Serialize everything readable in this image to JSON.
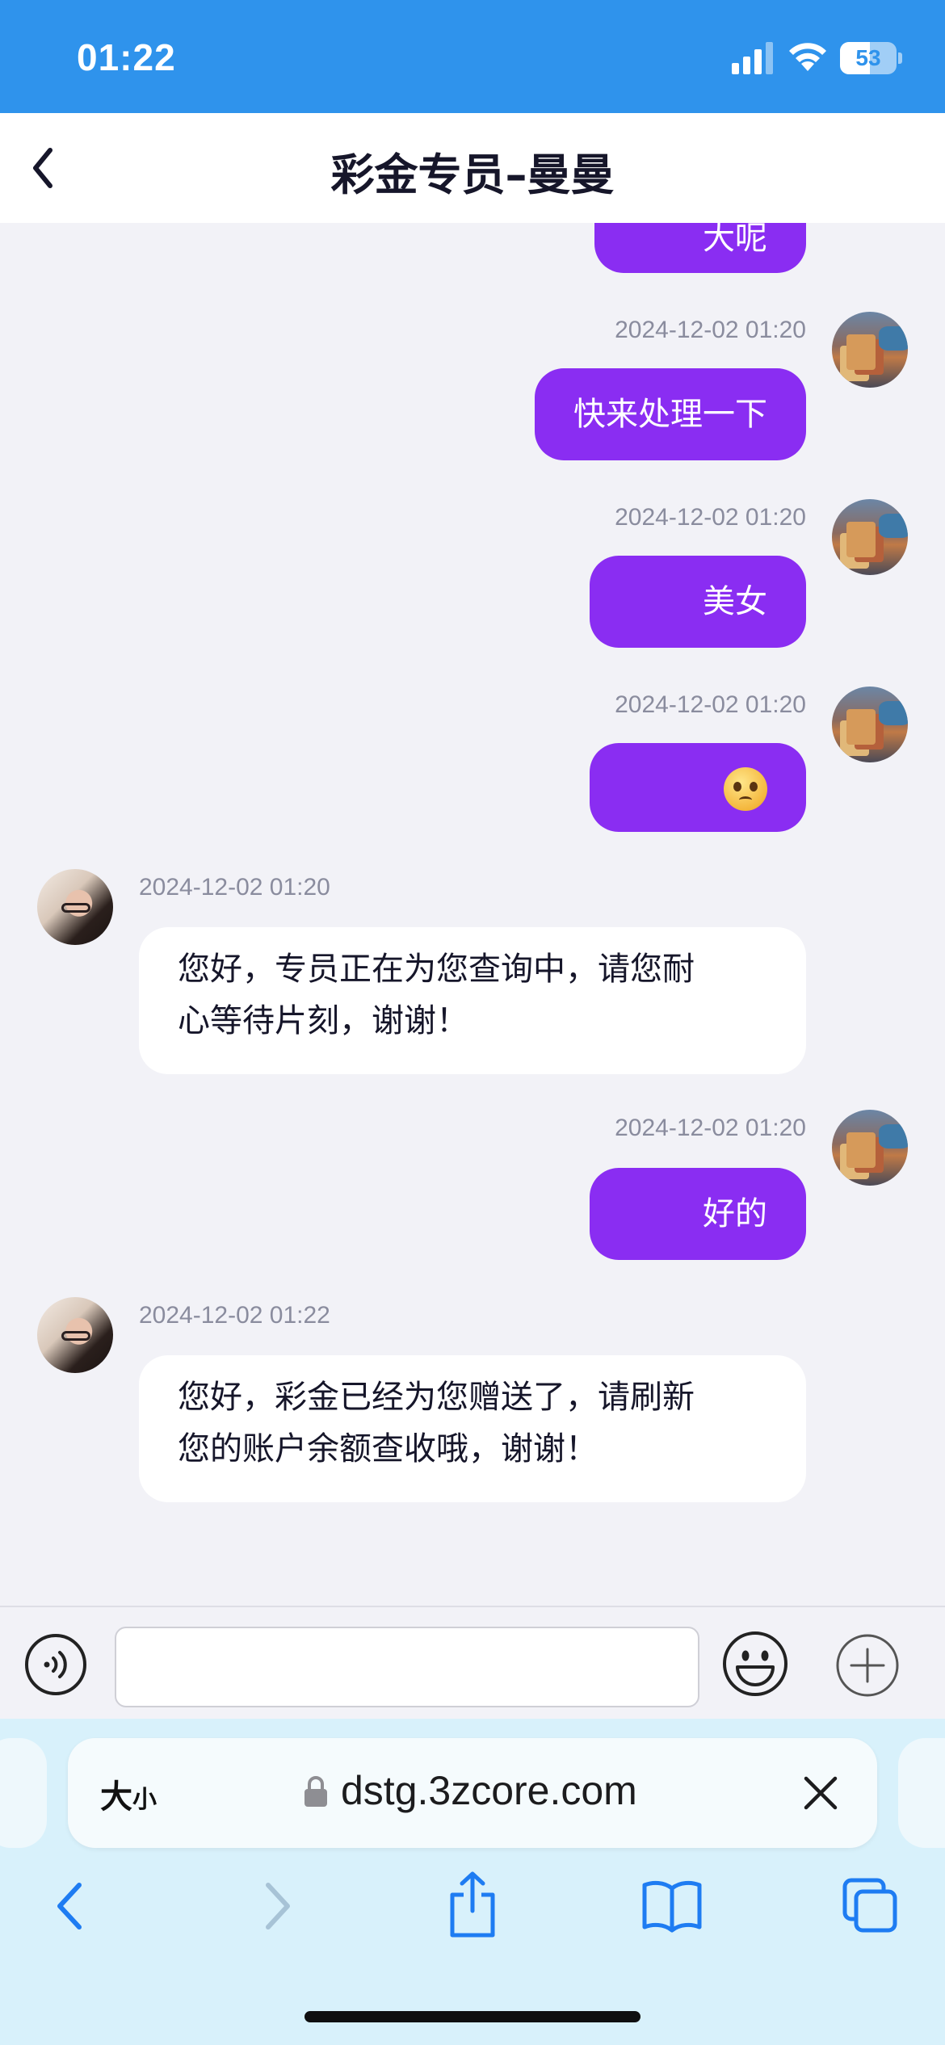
{
  "status": {
    "time": "01:22",
    "battery": "53",
    "battery_level": 0.53
  },
  "header": {
    "title": "彩金专员–曼曼"
  },
  "messages": [
    {
      "side": "sent",
      "text": "大呢",
      "timestamp": ""
    },
    {
      "side": "sent",
      "timestamp": "2024-12-02 01:20",
      "text": "快来处理一下"
    },
    {
      "side": "sent",
      "timestamp": "2024-12-02 01:20",
      "text": "美女"
    },
    {
      "side": "sent",
      "timestamp": "2024-12-02 01:20",
      "emoji": "pleading-face-emoji"
    },
    {
      "side": "received",
      "timestamp": "2024-12-02 01:20",
      "lines": [
        "您好，专员正在为您查询中，请您耐",
        "心等待片刻，谢谢！"
      ]
    },
    {
      "side": "sent",
      "timestamp": "2024-12-02 01:20",
      "text": "好的"
    },
    {
      "side": "received",
      "timestamp": "2024-12-02 01:22",
      "lines": [
        "您好，彩金已经为您赠送了，请刷新",
        "您的账户余额查收哦，谢谢！"
      ]
    }
  ],
  "browser": {
    "text_size_big": "大",
    "text_size_small": "小",
    "url": "dstg.3zcore.com"
  },
  "colors": {
    "status_bar": "#2f93ec",
    "sent_bubble": "#8a2df2",
    "received_bubble": "#ffffff",
    "chat_bg": "#f2f2f7",
    "safari_bg": "#d8f1fb"
  },
  "icons": [
    "back-chevron-icon",
    "signal-icon",
    "wifi-icon",
    "battery-icon",
    "voice-icon",
    "emoji-icon",
    "add-icon",
    "lock-icon",
    "close-icon",
    "safari-back-icon",
    "safari-forward-icon",
    "share-icon",
    "bookmarks-icon",
    "tabs-icon"
  ]
}
